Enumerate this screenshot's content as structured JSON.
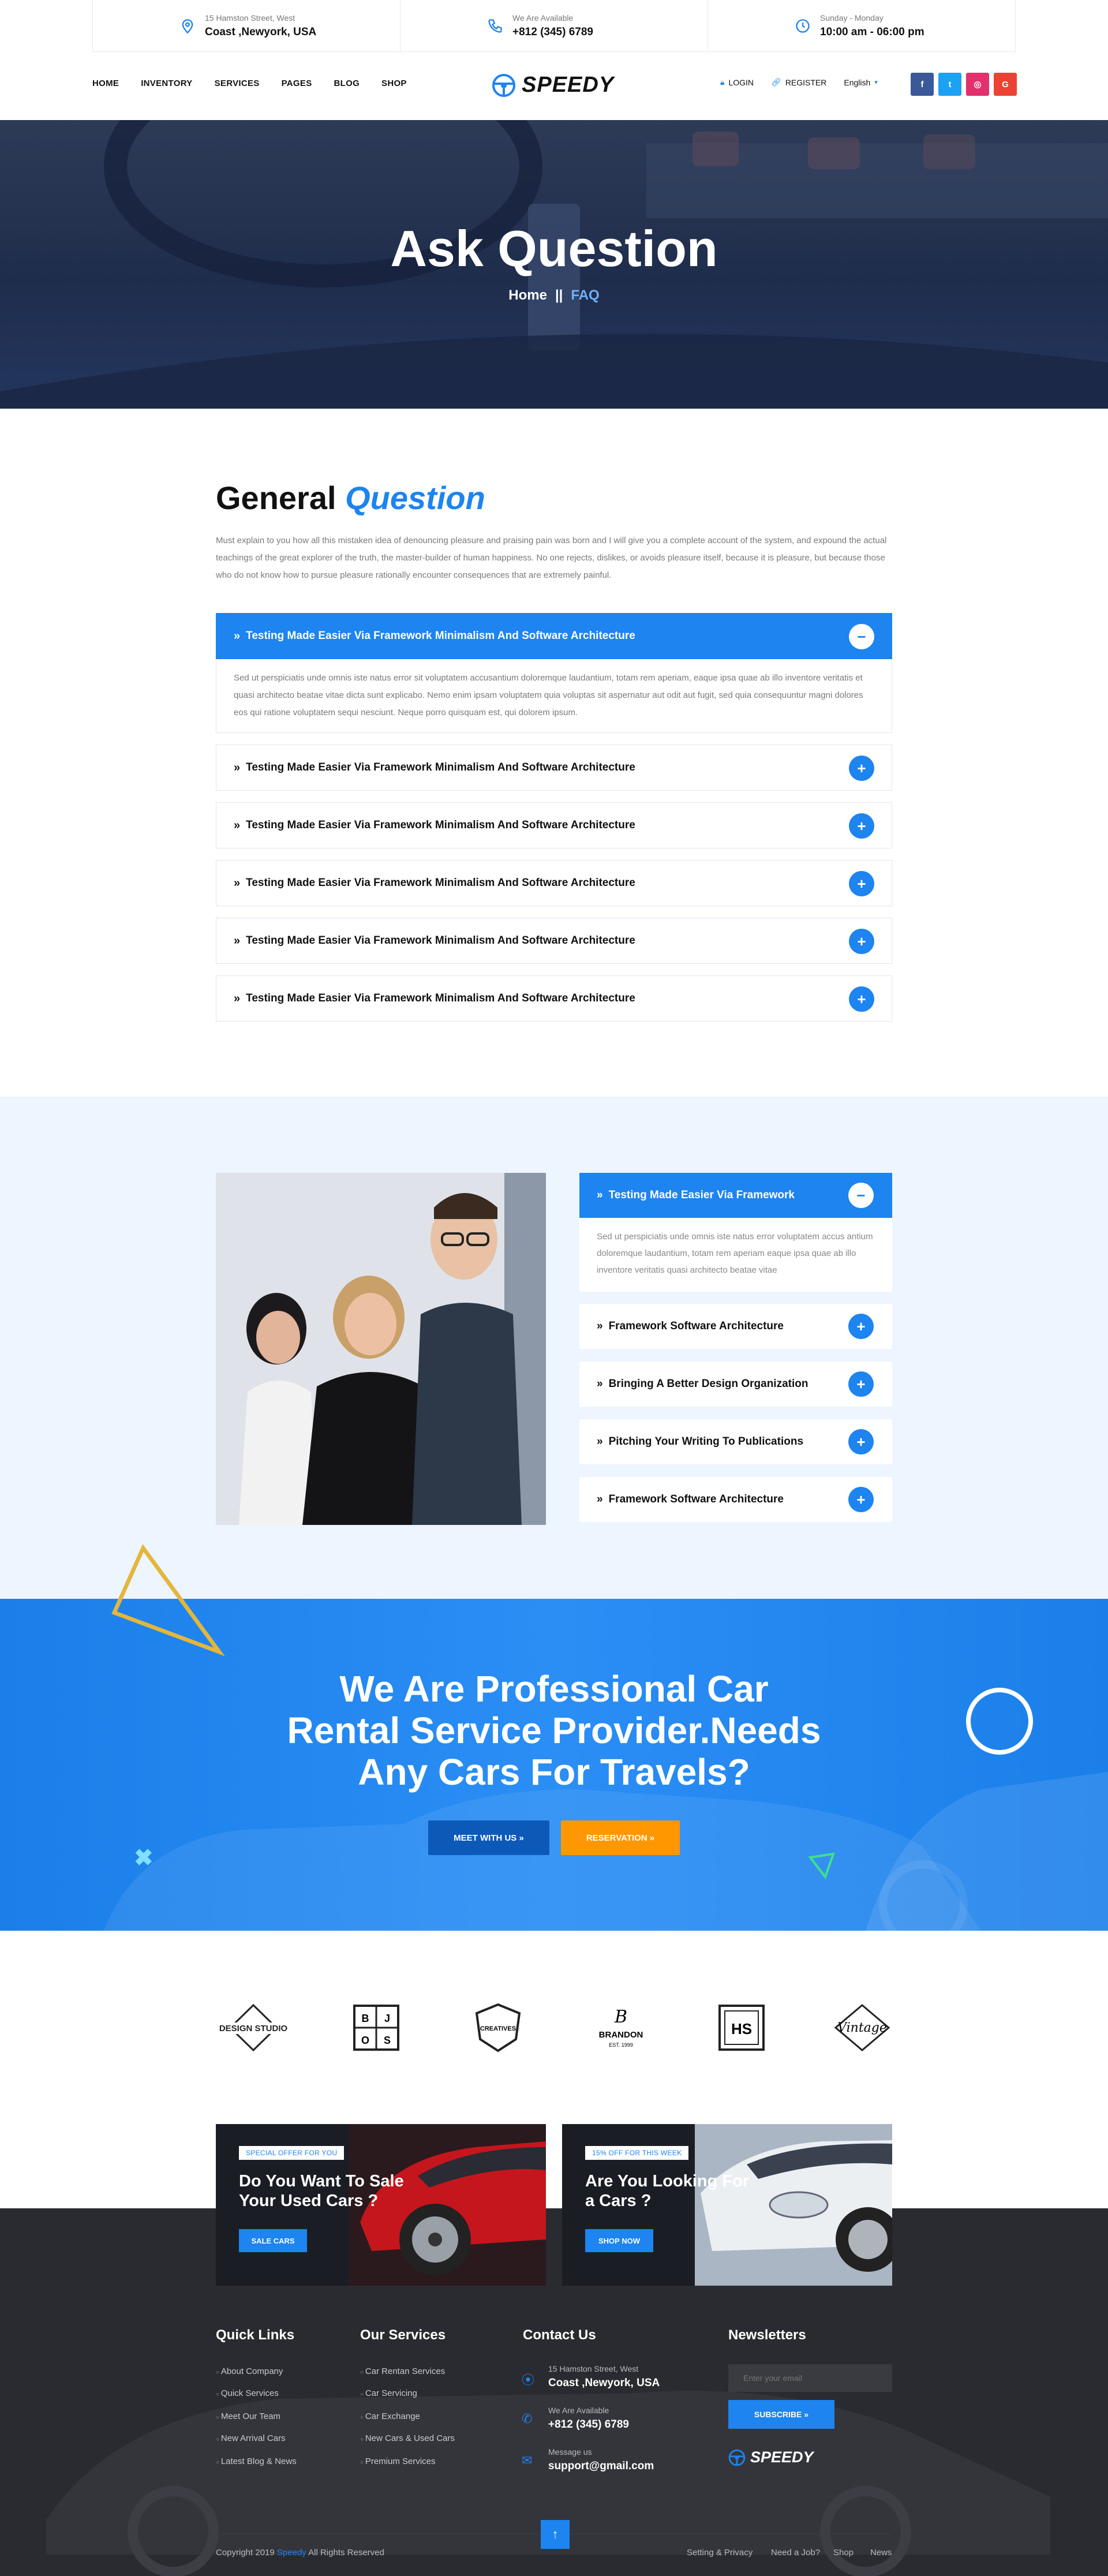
{
  "topbar": {
    "address_small": "15 Hamston Street, West",
    "address_big": "Coast ,Newyork, USA",
    "phone_small": "We Are Available",
    "phone_big": "+812 (345) 6789",
    "hours_small": "Sunday - Monday",
    "hours_big": "10:00 am - 06:00 pm"
  },
  "nav": {
    "menu": [
      "HOME",
      "INVENTORY",
      "SERVICES",
      "PAGES",
      "BLOG",
      "SHOP"
    ],
    "logo": "SPEEDY",
    "login": "LOGIN",
    "register": "REGISTER",
    "language": "English",
    "social": [
      "f",
      "t",
      "◎",
      "G"
    ]
  },
  "hero": {
    "title": "Ask Question",
    "crumb_home": "Home",
    "crumb_sep": "||",
    "crumb_current": "FAQ"
  },
  "general": {
    "title_plain": "General",
    "title_accent": "Question",
    "intro": "Must explain to you how all this mistaken idea of denouncing pleasure and praising pain was born and I will give you a complete account of the system, and expound the actual teachings of the great explorer of the truth, the master-builder of human happiness. No one rejects, dislikes, or avoids pleasure itself, because it is pleasure, but because those who do not know how to pursue pleasure rationally encounter consequences that are extremely painful.",
    "items": [
      "Testing Made Easier Via Framework Minimalism And Software Architecture",
      "Testing Made Easier Via Framework Minimalism And Software Architecture",
      "Testing Made Easier Via Framework Minimalism And Software Architecture",
      "Testing Made Easier Via Framework Minimalism And Software Architecture",
      "Testing Made Easier Via Framework Minimalism And Software Architecture",
      "Testing Made Easier Via Framework Minimalism And Software Architecture"
    ],
    "open_body": "Sed ut perspiciatis unde omnis iste natus error sit voluptatem accusantium doloremque laudantium, totam rem aperiam, eaque ipsa quae ab illo inventore veritatis et quasi architecto beatae vitae dicta sunt explicabo. Nemo enim ipsam voluptatem quia voluptas sit aspernatur aut odit aut fugit, sed quia consequuntur magni dolores eos qui ratione voluptatem sequi nesciunt. Neque porro quisquam est, qui dolorem ipsum."
  },
  "faq2": {
    "items": [
      "Testing Made Easier Via Framework",
      "Framework Software Architecture",
      "Bringing A Better Design Organization",
      "Pitching Your Writing To Publications",
      "Framework Software Architecture"
    ],
    "open_body": "Sed ut perspiciatis unde omnis iste natus error voluptatem accus antium doloremque laudantium, totam rem aperiam eaque ipsa quae ab illo inventore veritatis quasi architecto beatae vitae"
  },
  "cta": {
    "line1": "We Are Professional Car",
    "line2": "Rental Service Provider.Needs",
    "line3": "Any Cars For Travels?",
    "btn_meet": "MEET WITH US »",
    "btn_reserve": "RESERVATION »"
  },
  "brands": [
    "DESIGN STUDIO",
    "B J O S",
    "CREATIVES",
    "BRANDON",
    "HS",
    "Vintage"
  ],
  "promos": [
    {
      "tag": "SPECIAL OFFER FOR YOU",
      "title": "Do You Want To Sale Your Used Cars ?",
      "button": "SALE CARS"
    },
    {
      "tag": "15% OFF FOR THIS WEEK",
      "title": "Are You Looking For a Cars ?",
      "button": "SHOP NOW"
    }
  ],
  "footer": {
    "quick_title": "Quick Links",
    "quick": [
      "About Company",
      "Quick Services",
      "Meet Our Team",
      "New Arrival Cars",
      "Latest Blog & News"
    ],
    "services_title": "Our Services",
    "services": [
      "Car Rentan Services",
      "Car Servicing",
      "Car Exchange",
      "New Cars & Used Cars",
      "Premium Services"
    ],
    "contact_title": "Contact Us",
    "contact_address_small": "15 Hamston Street, West",
    "contact_address_big": "Coast ,Newyork, USA",
    "contact_phone_small": "We Are Available",
    "contact_phone_big": "+812 (345) 6789",
    "contact_mail_small": "Message us",
    "contact_mail_big": "support@gmail.com",
    "news_title": "Newsletters",
    "news_placeholder": "Enter your email",
    "subscribe": "SUBSCRIBE »",
    "logo": "SPEEDY",
    "copyright_pre": "Copyright  2019",
    "copyright_brand": "Speedy",
    "copyright_post": "All Rights Reserved",
    "bottom_links": [
      "Setting & Privacy",
      "Need a Job?",
      "Shop",
      "News"
    ]
  },
  "colors": {
    "accent": "#1d84f0",
    "orange": "#ff9800",
    "dark": "#2a2b30",
    "light_bg": "#edf5ff"
  }
}
